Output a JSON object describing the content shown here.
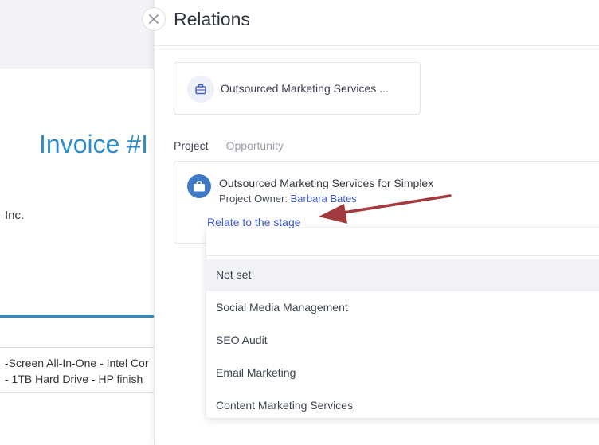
{
  "background": {
    "invoice_title": "Invoice #I",
    "company_fragment": "Inc.",
    "item_line_1": "-Screen All-In-One - Intel Cor",
    "item_line_2": "- 1TB Hard Drive - HP finish"
  },
  "panel": {
    "title": "Relations",
    "entity_label": "Outsourced Marketing Services ...",
    "tabs": [
      {
        "label": "Project",
        "active": true
      },
      {
        "label": "Opportunity",
        "active": false
      }
    ],
    "project": {
      "title": "Outsourced Marketing Services for Simplex",
      "owner_label": "Project Owner:",
      "owner_name": "Barbara Bates",
      "relate_link": "Relate to the stage"
    },
    "dropdown": {
      "search_value": "",
      "options": [
        {
          "label": "Not set",
          "selected": true
        },
        {
          "label": "Social Media Management",
          "selected": false
        },
        {
          "label": "SEO Audit",
          "selected": false
        },
        {
          "label": "Email Marketing",
          "selected": false
        },
        {
          "label": "Content Marketing Services",
          "selected": false
        }
      ]
    }
  },
  "icons": {
    "close": "close-icon",
    "entity": "briefcase-icon",
    "project": "briefcase-icon"
  },
  "colors": {
    "link": "#3e5bd6",
    "invoice_title": "#2e8dc9",
    "project_icon_bg": "#3d79c4",
    "annotation_arrow": "#a33a3f"
  }
}
